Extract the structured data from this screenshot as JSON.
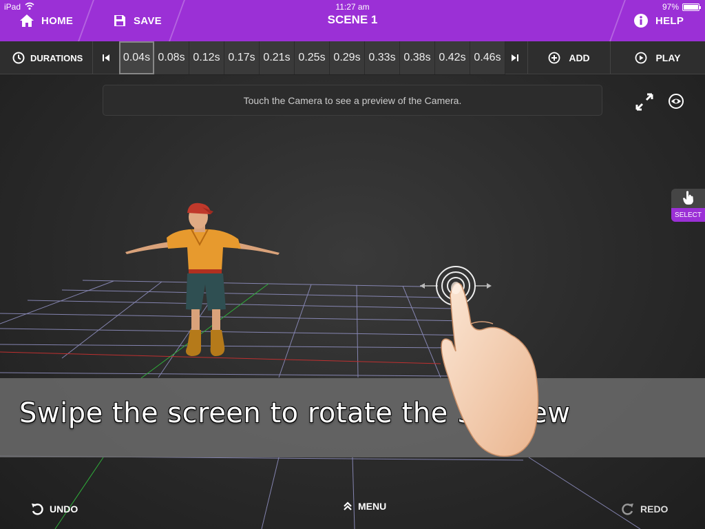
{
  "status": {
    "device": "iPad",
    "time": "11:27 am",
    "battery": "97%",
    "battery_level": 0.97
  },
  "topbar": {
    "home_label": "HOME",
    "save_label": "SAVE",
    "title": "SCENE 1",
    "help_label": "HELP",
    "color": "#9b30d6"
  },
  "timeline": {
    "durations_label": "DURATIONS",
    "frames": [
      "0.04s",
      "0.08s",
      "0.12s",
      "0.17s",
      "0.21s",
      "0.25s",
      "0.29s",
      "0.33s",
      "0.38s",
      "0.42s",
      "0.46s"
    ],
    "selected_index": 0,
    "add_label": "ADD",
    "play_label": "PLAY"
  },
  "viewport": {
    "camera_hint": "Touch the Camera to see a preview of the Camera.",
    "select_label": "SELECT"
  },
  "tutorial": {
    "text": "Swipe the screen to rotate the 3D view"
  },
  "bottom": {
    "undo_label": "UNDO",
    "menu_label": "MENU",
    "redo_label": "REDO"
  }
}
